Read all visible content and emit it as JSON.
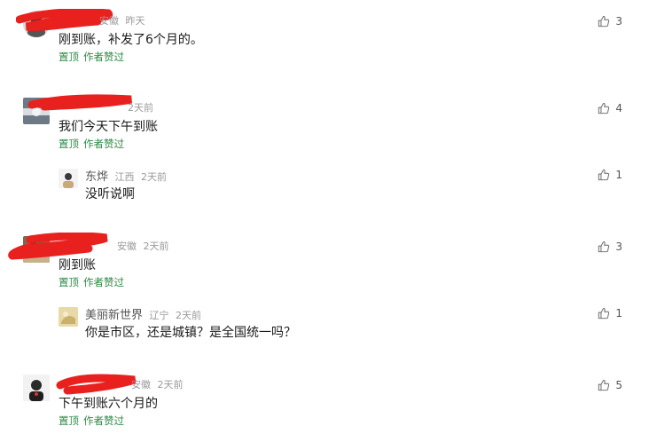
{
  "comments": [
    {
      "location": "安徽",
      "time": "昨天",
      "text": "刚到账，补发了6个月的。",
      "action_pin": "置顶",
      "action_liked": "作者赞过",
      "likes": "3"
    },
    {
      "location": "",
      "time": "2天前",
      "text": "我们今天下午到账",
      "action_pin": "置顶",
      "action_liked": "作者赞过",
      "likes": "4"
    },
    {
      "name": "东烨",
      "location": "江西",
      "time": "2天前",
      "text": "没听说啊",
      "likes": "1"
    },
    {
      "location": "安徽",
      "time": "2天前",
      "text": "刚到账",
      "action_pin": "置顶",
      "action_liked": "作者赞过",
      "likes": "3"
    },
    {
      "name": "美丽新世界",
      "location": "辽宁",
      "time": "2天前",
      "text": "你是市区，还是城镇？是全国统一吗？",
      "likes": "1"
    },
    {
      "location": "安徽",
      "time": "2天前",
      "text": "下午到账六个月的",
      "action_pin": "置顶",
      "action_liked": "作者赞过",
      "likes": "5"
    }
  ],
  "colors": {
    "accent_green": "#2f8a46",
    "redaction_red": "#e8211f",
    "meta_gray": "#9a9a9a"
  },
  "icons": {
    "like": "thumbs-up-icon"
  }
}
